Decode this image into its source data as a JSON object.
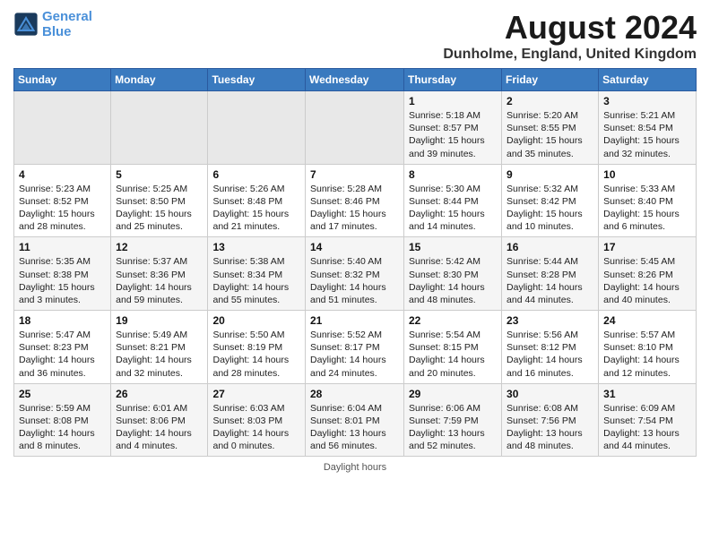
{
  "header": {
    "logo_line1": "General",
    "logo_line2": "Blue",
    "month_title": "August 2024",
    "location": "Dunholme, England, United Kingdom"
  },
  "days_of_week": [
    "Sunday",
    "Monday",
    "Tuesday",
    "Wednesday",
    "Thursday",
    "Friday",
    "Saturday"
  ],
  "footer": {
    "note": "Daylight hours"
  },
  "weeks": [
    [
      {
        "day": "",
        "info": ""
      },
      {
        "day": "",
        "info": ""
      },
      {
        "day": "",
        "info": ""
      },
      {
        "day": "",
        "info": ""
      },
      {
        "day": "1",
        "info": "Sunrise: 5:18 AM\nSunset: 8:57 PM\nDaylight: 15 hours\nand 39 minutes."
      },
      {
        "day": "2",
        "info": "Sunrise: 5:20 AM\nSunset: 8:55 PM\nDaylight: 15 hours\nand 35 minutes."
      },
      {
        "day": "3",
        "info": "Sunrise: 5:21 AM\nSunset: 8:54 PM\nDaylight: 15 hours\nand 32 minutes."
      }
    ],
    [
      {
        "day": "4",
        "info": "Sunrise: 5:23 AM\nSunset: 8:52 PM\nDaylight: 15 hours\nand 28 minutes."
      },
      {
        "day": "5",
        "info": "Sunrise: 5:25 AM\nSunset: 8:50 PM\nDaylight: 15 hours\nand 25 minutes."
      },
      {
        "day": "6",
        "info": "Sunrise: 5:26 AM\nSunset: 8:48 PM\nDaylight: 15 hours\nand 21 minutes."
      },
      {
        "day": "7",
        "info": "Sunrise: 5:28 AM\nSunset: 8:46 PM\nDaylight: 15 hours\nand 17 minutes."
      },
      {
        "day": "8",
        "info": "Sunrise: 5:30 AM\nSunset: 8:44 PM\nDaylight: 15 hours\nand 14 minutes."
      },
      {
        "day": "9",
        "info": "Sunrise: 5:32 AM\nSunset: 8:42 PM\nDaylight: 15 hours\nand 10 minutes."
      },
      {
        "day": "10",
        "info": "Sunrise: 5:33 AM\nSunset: 8:40 PM\nDaylight: 15 hours\nand 6 minutes."
      }
    ],
    [
      {
        "day": "11",
        "info": "Sunrise: 5:35 AM\nSunset: 8:38 PM\nDaylight: 15 hours\nand 3 minutes."
      },
      {
        "day": "12",
        "info": "Sunrise: 5:37 AM\nSunset: 8:36 PM\nDaylight: 14 hours\nand 59 minutes."
      },
      {
        "day": "13",
        "info": "Sunrise: 5:38 AM\nSunset: 8:34 PM\nDaylight: 14 hours\nand 55 minutes."
      },
      {
        "day": "14",
        "info": "Sunrise: 5:40 AM\nSunset: 8:32 PM\nDaylight: 14 hours\nand 51 minutes."
      },
      {
        "day": "15",
        "info": "Sunrise: 5:42 AM\nSunset: 8:30 PM\nDaylight: 14 hours\nand 48 minutes."
      },
      {
        "day": "16",
        "info": "Sunrise: 5:44 AM\nSunset: 8:28 PM\nDaylight: 14 hours\nand 44 minutes."
      },
      {
        "day": "17",
        "info": "Sunrise: 5:45 AM\nSunset: 8:26 PM\nDaylight: 14 hours\nand 40 minutes."
      }
    ],
    [
      {
        "day": "18",
        "info": "Sunrise: 5:47 AM\nSunset: 8:23 PM\nDaylight: 14 hours\nand 36 minutes."
      },
      {
        "day": "19",
        "info": "Sunrise: 5:49 AM\nSunset: 8:21 PM\nDaylight: 14 hours\nand 32 minutes."
      },
      {
        "day": "20",
        "info": "Sunrise: 5:50 AM\nSunset: 8:19 PM\nDaylight: 14 hours\nand 28 minutes."
      },
      {
        "day": "21",
        "info": "Sunrise: 5:52 AM\nSunset: 8:17 PM\nDaylight: 14 hours\nand 24 minutes."
      },
      {
        "day": "22",
        "info": "Sunrise: 5:54 AM\nSunset: 8:15 PM\nDaylight: 14 hours\nand 20 minutes."
      },
      {
        "day": "23",
        "info": "Sunrise: 5:56 AM\nSunset: 8:12 PM\nDaylight: 14 hours\nand 16 minutes."
      },
      {
        "day": "24",
        "info": "Sunrise: 5:57 AM\nSunset: 8:10 PM\nDaylight: 14 hours\nand 12 minutes."
      }
    ],
    [
      {
        "day": "25",
        "info": "Sunrise: 5:59 AM\nSunset: 8:08 PM\nDaylight: 14 hours\nand 8 minutes."
      },
      {
        "day": "26",
        "info": "Sunrise: 6:01 AM\nSunset: 8:06 PM\nDaylight: 14 hours\nand 4 minutes."
      },
      {
        "day": "27",
        "info": "Sunrise: 6:03 AM\nSunset: 8:03 PM\nDaylight: 14 hours\nand 0 minutes."
      },
      {
        "day": "28",
        "info": "Sunrise: 6:04 AM\nSunset: 8:01 PM\nDaylight: 13 hours\nand 56 minutes."
      },
      {
        "day": "29",
        "info": "Sunrise: 6:06 AM\nSunset: 7:59 PM\nDaylight: 13 hours\nand 52 minutes."
      },
      {
        "day": "30",
        "info": "Sunrise: 6:08 AM\nSunset: 7:56 PM\nDaylight: 13 hours\nand 48 minutes."
      },
      {
        "day": "31",
        "info": "Sunrise: 6:09 AM\nSunset: 7:54 PM\nDaylight: 13 hours\nand 44 minutes."
      }
    ]
  ]
}
